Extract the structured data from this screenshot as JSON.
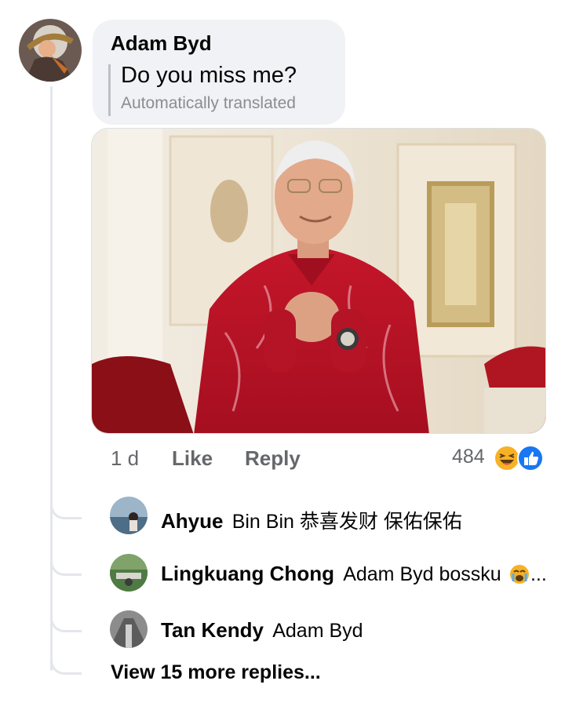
{
  "comment": {
    "author": "Adam Byd",
    "text": "Do you miss me?",
    "translation_note": "Automatically translated",
    "time": "1 d",
    "like_label": "Like",
    "reply_label": "Reply",
    "reaction_count": "484",
    "reaction_icons": [
      "haha-icon",
      "like-icon"
    ]
  },
  "replies": [
    {
      "author": "Ahyue",
      "text": "Bin Bin 恭喜发财 保佑保佑"
    },
    {
      "author": "Lingkuang Chong",
      "text": "Adam Byd bossku",
      "trailing": "..."
    },
    {
      "author": "Tan Kendy",
      "text": "Adam Byd"
    }
  ],
  "view_more": "View 15 more replies...",
  "colors": {
    "bubble": "#f0f2f5",
    "meta_text": "#65676b",
    "like_blue": "#1877f2",
    "haha_yellow": "#f7b125"
  }
}
